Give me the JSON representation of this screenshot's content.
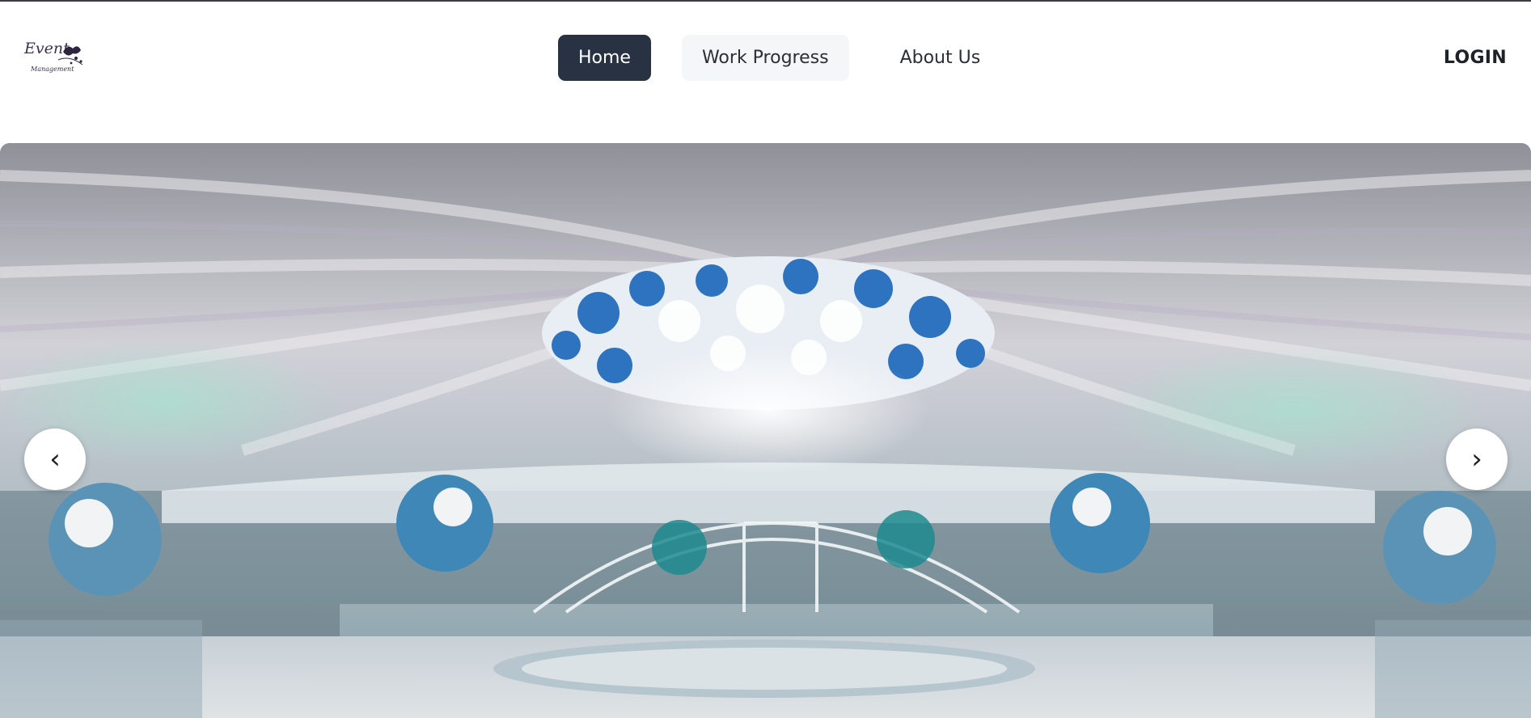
{
  "logo": {
    "line1": "Event",
    "line2": "Management"
  },
  "nav": {
    "items": [
      {
        "label": "Home",
        "state": "active"
      },
      {
        "label": "Work Progress",
        "state": "hover"
      },
      {
        "label": "About Us",
        "state": "normal"
      }
    ]
  },
  "header": {
    "login_label": "LOGIN"
  },
  "carousel": {
    "prev_label": "‹",
    "next_label": "›",
    "slide_description_icon": "event-hall-photo"
  },
  "colors": {
    "active_nav_bg": "#283242",
    "hover_nav_bg": "#f5f6f7",
    "text": "#2b2f36"
  }
}
